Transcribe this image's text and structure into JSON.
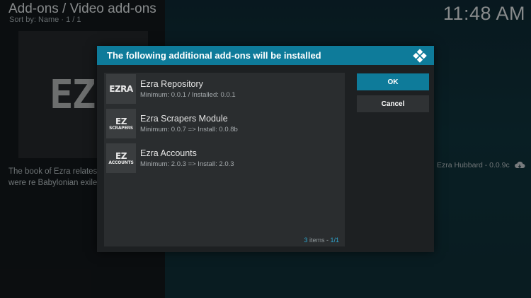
{
  "header": {
    "title": "Add-ons / Video add-ons",
    "subtitle": "Sort by: Name  ·  1 / 1",
    "clock": "11:48 AM"
  },
  "background": {
    "art_text": "EZR",
    "description": "The book of Ezra relates covenant people were re Babylonian exile to the c",
    "author": "Ezra Hubbard - 0.0.9c"
  },
  "dialog": {
    "title": "The following additional add-ons will be installed",
    "items": [
      {
        "thumb_big": "EZRA",
        "thumb_small": "",
        "title": "Ezra Repository",
        "subtitle": "Minimum: 0.0.1 / Installed: 0.0.1"
      },
      {
        "thumb_big": "EZ",
        "thumb_small": "SCRAPERS",
        "title": "Ezra Scrapers Module",
        "subtitle": "Minimum: 0.0.7 => Install: 0.0.8b"
      },
      {
        "thumb_big": "EZ",
        "thumb_small": "ACCOUNTS",
        "title": "Ezra Accounts",
        "subtitle": "Minimum: 2.0.3 => Install: 2.0.3"
      }
    ],
    "footer": {
      "count": "3",
      "items_label": "items - ",
      "page": "1/1"
    },
    "ok_label": "OK",
    "cancel_label": "Cancel"
  },
  "colors": {
    "accent": "#0e7b9a",
    "highlight": "#2ea6cf"
  },
  "icons": [
    "kodi-logo-icon",
    "cloud-download-icon"
  ]
}
